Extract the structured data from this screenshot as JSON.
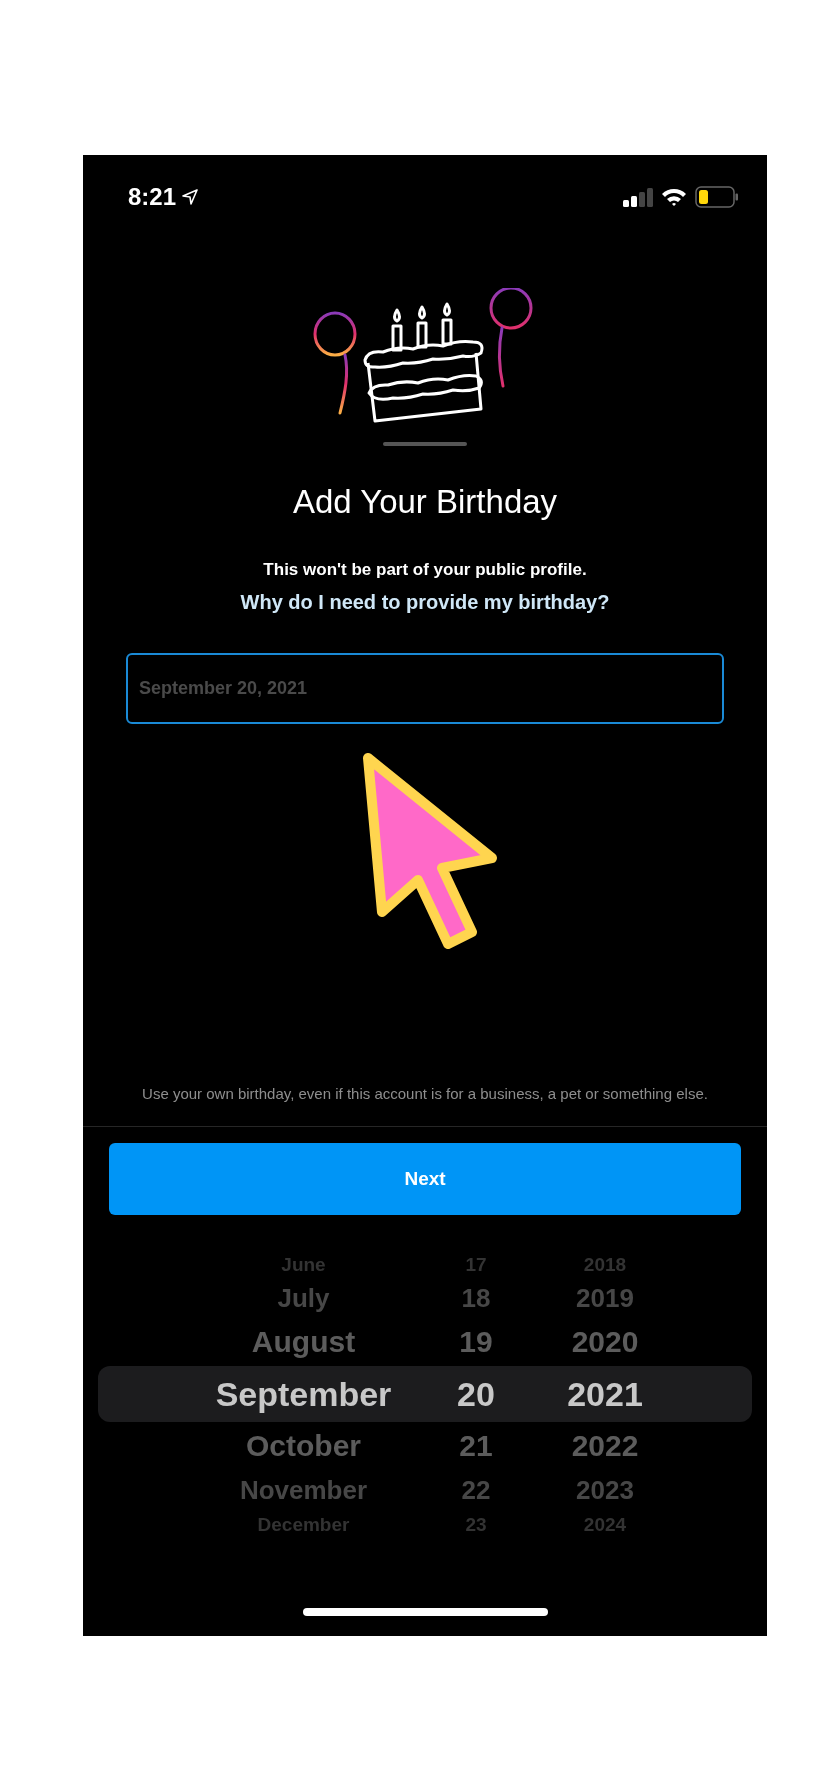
{
  "status_bar": {
    "time": "8:21"
  },
  "title": "Add Your Birthday",
  "subtitle": "This won't be part of your public profile.",
  "help_link": "Why do I need to provide my birthday?",
  "date_field": {
    "value": "September 20, 2021"
  },
  "note": "Use your own birthday, even if this account is for a business, a pet or something else.",
  "next_button": "Next",
  "picker": {
    "rows": [
      {
        "month": "June",
        "day": "17",
        "year": "2018",
        "selected": false
      },
      {
        "month": "July",
        "day": "18",
        "year": "2019",
        "selected": false
      },
      {
        "month": "August",
        "day": "19",
        "year": "2020",
        "selected": false
      },
      {
        "month": "September",
        "day": "20",
        "year": "2021",
        "selected": true
      },
      {
        "month": "October",
        "day": "21",
        "year": "2022",
        "selected": false
      },
      {
        "month": "November",
        "day": "22",
        "year": "2023",
        "selected": false
      },
      {
        "month": "December",
        "day": "23",
        "year": "2024",
        "selected": false
      }
    ]
  }
}
